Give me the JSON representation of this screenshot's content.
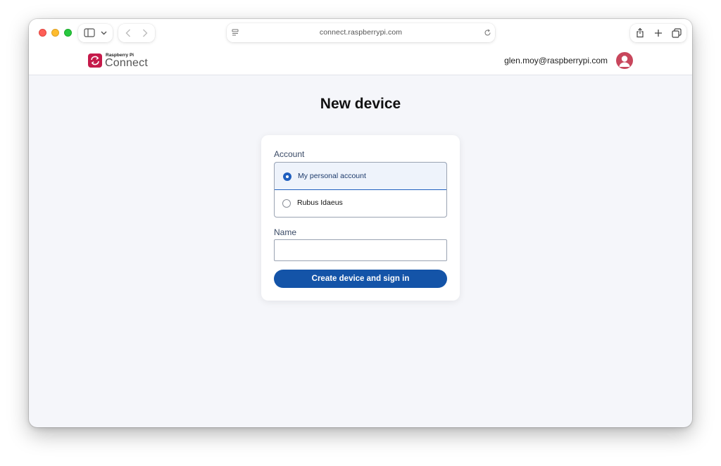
{
  "browser": {
    "url": "connect.raspberrypi.com",
    "icons": [
      "sidebar-icon",
      "chevron-down-icon",
      "back-icon",
      "forward-icon",
      "page-menu-icon",
      "reload-icon",
      "share-icon",
      "new-tab-icon",
      "tabs-overview-icon"
    ]
  },
  "header": {
    "logo_small": "Raspberry Pi",
    "logo_big": "Connect",
    "user_email": "glen.moy@raspberrypi.com"
  },
  "page": {
    "title": "New device"
  },
  "form": {
    "account_label": "Account",
    "accounts": [
      {
        "label": "My personal account",
        "selected": true
      },
      {
        "label": "Rubus Idaeus",
        "selected": false
      }
    ],
    "name_label": "Name",
    "name_value": "",
    "name_placeholder": "",
    "submit_label": "Create device and sign in"
  },
  "colors": {
    "brand_red": "#c51a4a",
    "primary_blue": "#1454a8",
    "page_bg": "#f5f6fa"
  }
}
